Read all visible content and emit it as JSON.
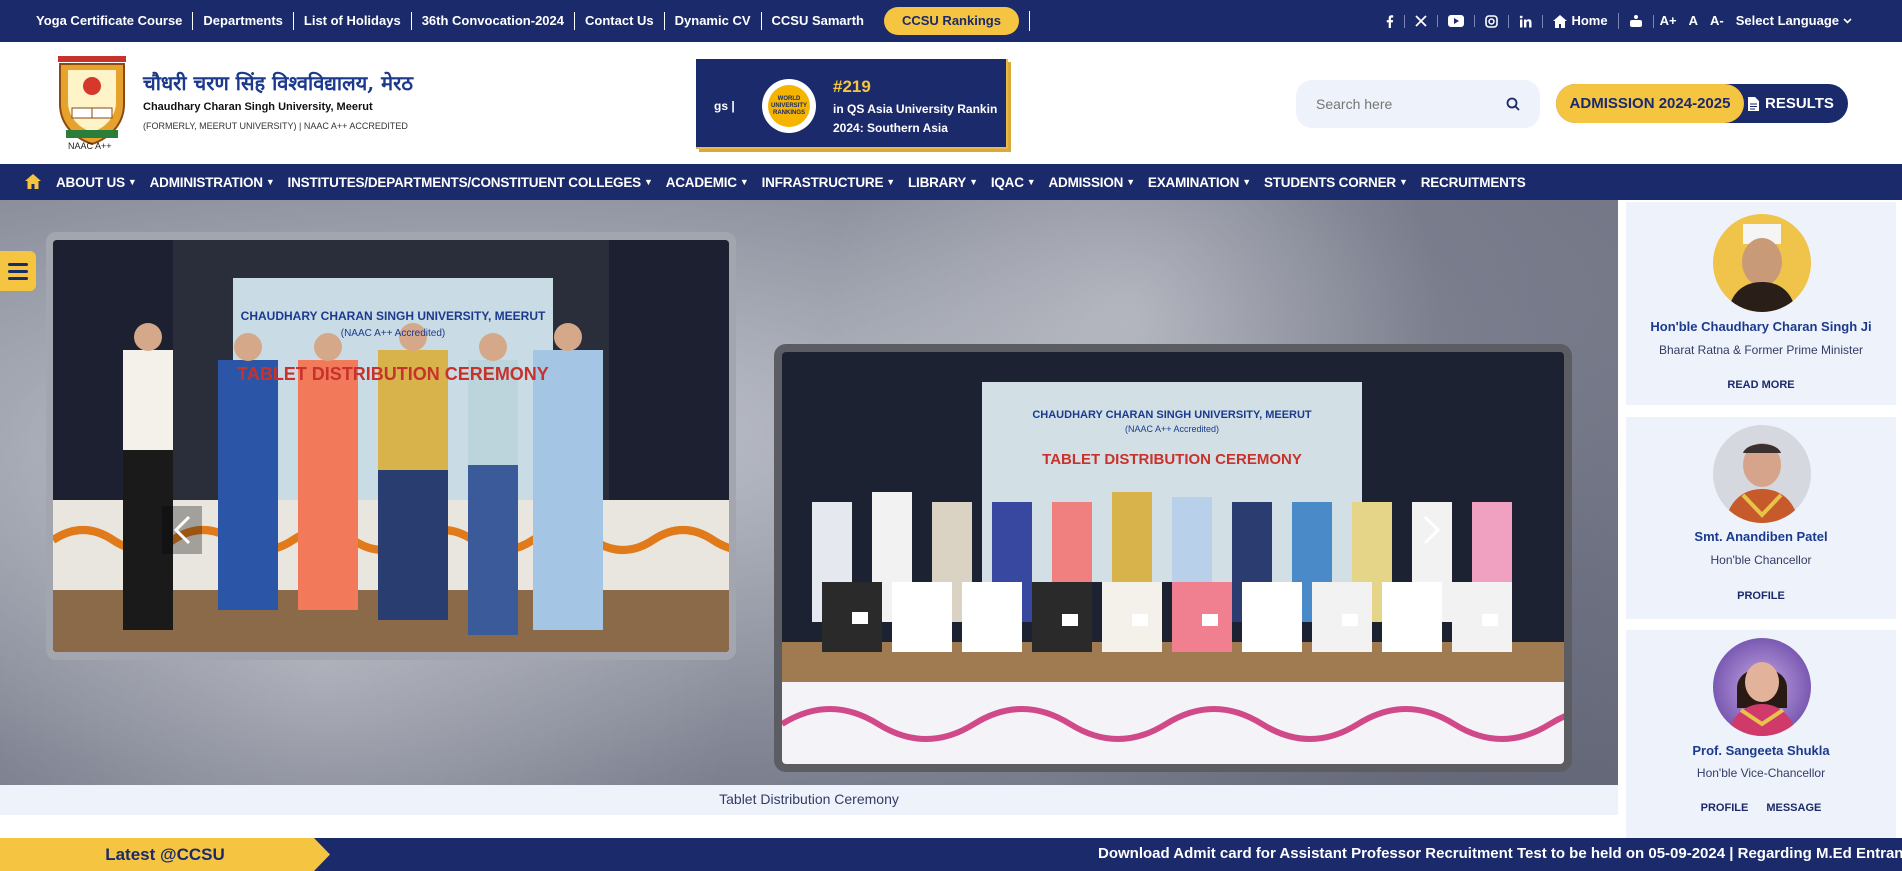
{
  "topbar": {
    "links": [
      "Yoga Certificate Course",
      "Departments",
      "List of Holidays",
      "36th Convocation-2024",
      "Contact Us",
      "Dynamic CV",
      "CCSU Samarth"
    ],
    "rankings_button": "CCSU Rankings",
    "home_label": "Home",
    "font_increase": "A+",
    "font_normal": "A",
    "font_decrease": "A-",
    "language_label": "Select Language"
  },
  "header": {
    "hindi_name": "चौधरी चरण सिंह विश्वविद्यालय, मेरठ",
    "english_name": "Chaudhary Charan Singh University, Meerut",
    "subtitle": "(FORMERLY, MEERUT UNIVERSITY) | NAAC A++ ACCREDITED",
    "naac_label": "NAAC A++"
  },
  "qs_banner": {
    "prefix": "gs |",
    "badge_text": "WORLD UNIVERSITY RANKINGS",
    "rank": "#219",
    "text": "in QS Asia University Rankin 2024: Southern Asia"
  },
  "search": {
    "placeholder": "Search here"
  },
  "admission_button": "ADMISSION 2024-2025",
  "results_button": "RESULTS",
  "nav": {
    "items": [
      "ABOUT US",
      "ADMINISTRATION",
      "INSTITUTES/DEPARTMENTS/CONSTITUENT COLLEGES",
      "ACADEMIC",
      "INFRASTRUCTURE",
      "LIBRARY",
      "IQAC",
      "ADMISSION",
      "EXAMINATION",
      "STUDENTS CORNER",
      "RECRUITMENTS"
    ]
  },
  "slider": {
    "photo1_banner": "CHAUDHARY CHARAN SINGH UNIVERSITY, MEERUT",
    "photo1_sub": "(NAAC A++ Accredited)",
    "photo1_title": "TABLET DISTRIBUTION CEREMONY",
    "photo2_banner": "CHAUDHARY CHARAN SINGH UNIVERSITY, MEERUT",
    "photo2_sub": "(NAAC A++ Accredited)",
    "photo2_title": "TABLET DISTRIBUTION CEREMONY",
    "caption": "Tablet Distribution Ceremony"
  },
  "sidebar": {
    "cards": [
      {
        "name": "Hon'ble Chaudhary Charan Singh Ji",
        "role": "Bharat Ratna & Former Prime Minister",
        "links": [
          "READ MORE"
        ]
      },
      {
        "name": "Smt. Anandiben Patel",
        "role": "Hon'ble Chancellor",
        "links": [
          "PROFILE"
        ]
      },
      {
        "name": "Prof. Sangeeta Shukla",
        "role": "Hon'ble Vice-Chancellor",
        "links": [
          "PROFILE",
          "MESSAGE"
        ]
      }
    ]
  },
  "ticker": {
    "label": "Latest @CCSU",
    "message": "Download Admit card for Assistant Professor Recruitment Test to be held on 05-09-2024   |   Regarding M.Ed Entrance"
  },
  "colors": {
    "navy": "#1b2a6b",
    "gold": "#f5c542",
    "light": "#eef2fa",
    "link_blue": "#1b3a8e"
  }
}
